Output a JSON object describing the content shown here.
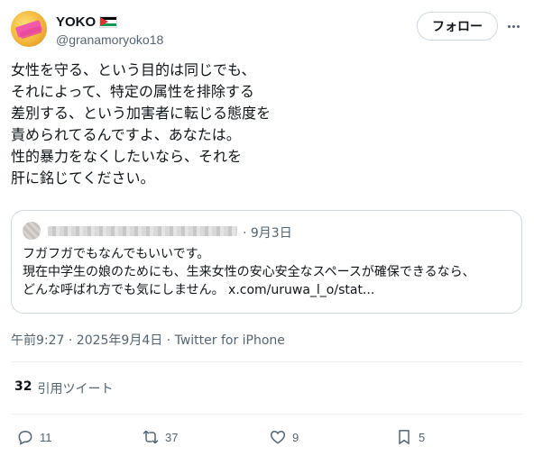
{
  "author": {
    "display_name": "YOKO",
    "handle": "@granamoryoko18",
    "flag_icon": "palestine-flag-icon",
    "avatar_text": ""
  },
  "header": {
    "follow_label": "フォロー",
    "more_icon": "more-horizontal-icon"
  },
  "tweet": {
    "lines": [
      "女性を守る、という目的は同じでも、",
      "それによって、特定の属性を排除する",
      "差別する、という加害者に転じる態度を",
      "責められてるんですよ、あなたは。",
      "性的暴力をなくしたいなら、それを",
      "肝に銘じてください。"
    ]
  },
  "quote": {
    "date": "· 9月3日",
    "lines": [
      "フガフガでもなんでもいいです。",
      "現在中学生の娘のためにも、生来女性の安心安全なスペースが確保できるなら、",
      "どんな呼ばれ方でも気にしません。 x.com/uruwa_l_o/stat..."
    ]
  },
  "timestamp": "午前9:27 · 2025年9月4日 · Twitter for iPhone",
  "quote_stats": {
    "count": "32",
    "label": "引用ツイート"
  },
  "actions": {
    "reply_count": "11",
    "retweet_count": "37",
    "like_count": "9",
    "bookmark_count": "5"
  },
  "colors": {
    "text": "#0f1419",
    "secondary": "#536471",
    "border": "#cfd9de"
  }
}
